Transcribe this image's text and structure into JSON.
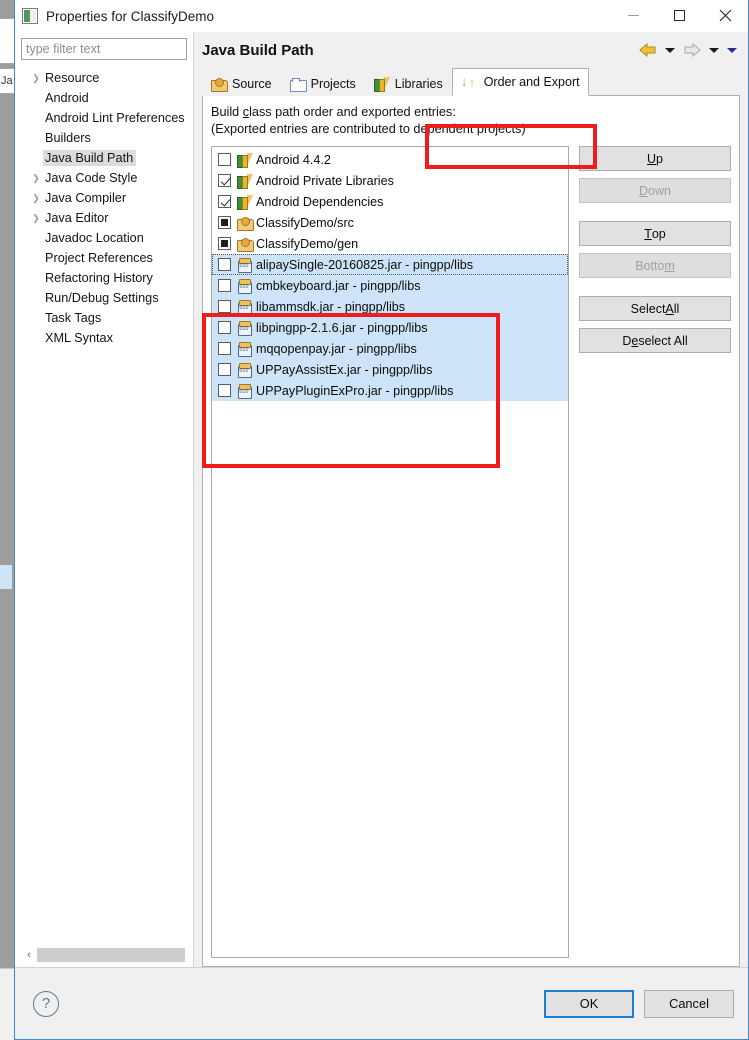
{
  "window": {
    "title": "Properties for ClassifyDemo",
    "icon": "properties-icon",
    "minimize_label": "–",
    "maximize_label": "□",
    "close_label": "✕"
  },
  "background": {
    "fragment_text": "Ja"
  },
  "sidebar": {
    "filter_placeholder": "type filter text",
    "items": [
      {
        "label": "Resource",
        "expandable": true,
        "selected": false
      },
      {
        "label": "Android",
        "expandable": false,
        "selected": false
      },
      {
        "label": "Android Lint Preferences",
        "expandable": false,
        "selected": false
      },
      {
        "label": "Builders",
        "expandable": false,
        "selected": false
      },
      {
        "label": "Java Build Path",
        "expandable": false,
        "selected": true
      },
      {
        "label": "Java Code Style",
        "expandable": true,
        "selected": false
      },
      {
        "label": "Java Compiler",
        "expandable": true,
        "selected": false
      },
      {
        "label": "Java Editor",
        "expandable": true,
        "selected": false
      },
      {
        "label": "Javadoc Location",
        "expandable": false,
        "selected": false
      },
      {
        "label": "Project References",
        "expandable": false,
        "selected": false
      },
      {
        "label": "Refactoring History",
        "expandable": false,
        "selected": false
      },
      {
        "label": "Run/Debug Settings",
        "expandable": false,
        "selected": false
      },
      {
        "label": "Task Tags",
        "expandable": false,
        "selected": false
      },
      {
        "label": "XML Syntax",
        "expandable": false,
        "selected": false
      }
    ],
    "scroll_left_label": "‹",
    "scroll_right_label": "›"
  },
  "header": {
    "page_title": "Java Build Path",
    "back_arrow": "back-arrow-icon",
    "forward_arrow": "forward-arrow-icon",
    "dropdown_caret": "chevron-down-icon"
  },
  "tabs": [
    {
      "label": "Source",
      "icon": "package-icon",
      "active": false
    },
    {
      "label": "Projects",
      "icon": "folder-icon",
      "active": false
    },
    {
      "label": "Libraries",
      "icon": "books-icon",
      "active": false
    },
    {
      "label": "Order and Export",
      "icon": "order-arrows-icon",
      "active": true
    }
  ],
  "panel": {
    "description_line1_pre": "Build ",
    "description_line1_mnemonic": "c",
    "description_line1_post": "lass path order and exported entries:",
    "description_line2": "(Exported entries are contributed to dependent projects)"
  },
  "entries": [
    {
      "label": "Android 4.4.2",
      "checkbox": "unchecked",
      "icon": "books-icon",
      "selected": false,
      "focused": false
    },
    {
      "label": "Android Private Libraries",
      "checkbox": "checked",
      "icon": "books-icon",
      "selected": false,
      "focused": false
    },
    {
      "label": "Android Dependencies",
      "checkbox": "checked",
      "icon": "books-icon",
      "selected": false,
      "focused": false
    },
    {
      "label": "ClassifyDemo/src",
      "checkbox": "filled",
      "icon": "package-icon",
      "selected": false,
      "focused": false
    },
    {
      "label": "ClassifyDemo/gen",
      "checkbox": "filled",
      "icon": "package-icon",
      "selected": false,
      "focused": false
    },
    {
      "label": "alipaySingle-20160825.jar - pingpp/libs",
      "checkbox": "unchecked",
      "icon": "jar-icon",
      "selected": true,
      "focused": true
    },
    {
      "label": "cmbkeyboard.jar - pingpp/libs",
      "checkbox": "unchecked",
      "icon": "jar-icon",
      "selected": true,
      "focused": false
    },
    {
      "label": "libammsdk.jar - pingpp/libs",
      "checkbox": "unchecked",
      "icon": "jar-icon",
      "selected": true,
      "focused": false
    },
    {
      "label": "libpingpp-2.1.6.jar - pingpp/libs",
      "checkbox": "unchecked",
      "icon": "jar-icon",
      "selected": true,
      "focused": false
    },
    {
      "label": "mqqopenpay.jar - pingpp/libs",
      "checkbox": "unchecked",
      "icon": "jar-icon",
      "selected": true,
      "focused": false
    },
    {
      "label": "UPPayAssistEx.jar - pingpp/libs",
      "checkbox": "unchecked",
      "icon": "jar-icon",
      "selected": true,
      "focused": false
    },
    {
      "label": "UPPayPluginExPro.jar - pingpp/libs",
      "checkbox": "unchecked",
      "icon": "jar-icon",
      "selected": true,
      "focused": false
    }
  ],
  "side_buttons": {
    "up": {
      "pre": "",
      "mnemonic": "U",
      "post": "p",
      "disabled": false
    },
    "down": {
      "pre": "",
      "mnemonic": "D",
      "post": "own",
      "disabled": true
    },
    "top": {
      "pre": "",
      "mnemonic": "T",
      "post": "op",
      "disabled": false
    },
    "bottom": {
      "pre": "Botto",
      "mnemonic": "m",
      "post": "",
      "disabled": true
    },
    "select_all": {
      "pre": "Select ",
      "mnemonic": "A",
      "post": "ll",
      "disabled": false
    },
    "deselect_all": {
      "pre": "D",
      "mnemonic": "e",
      "post": "select All",
      "disabled": false
    }
  },
  "footer": {
    "help_label": "?",
    "ok_label": "OK",
    "cancel_label": "Cancel"
  },
  "annotations": {
    "tab_highlight_color": "#ee1c1c",
    "list_highlight_color": "#ee1c1c"
  }
}
